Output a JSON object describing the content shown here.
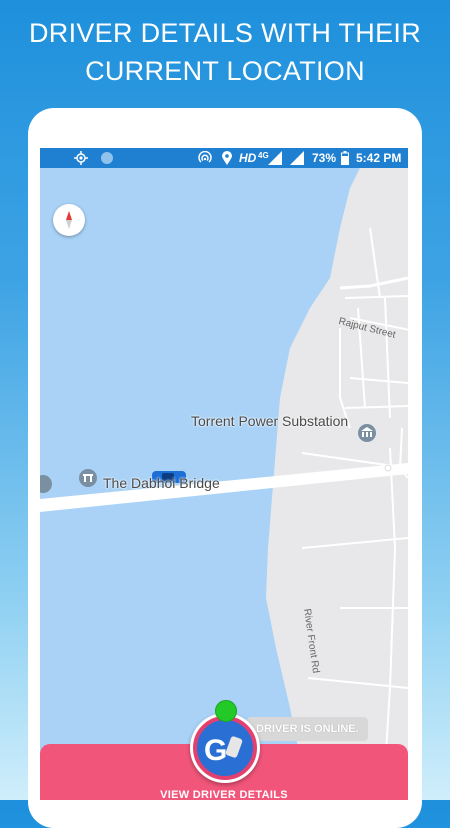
{
  "header": {
    "line1": "DRIVER DETAILS WITH THEIR",
    "line2": "CURRENT LOCATION"
  },
  "status_bar": {
    "network": "HD",
    "network_type": "4G",
    "battery": "73%",
    "time": "5:42 PM"
  },
  "map": {
    "labels": {
      "bridge": "The Dabhoi Bridge",
      "substation": "Torrent Power Substation",
      "street1": "Rajput Street",
      "street2": "River Front Rd"
    }
  },
  "driver_status": "DRIVER IS ONLINE.",
  "cta_label": "VIEW DRIVER DETAILS",
  "colors": {
    "status_bar": "#1f7fd0",
    "water": "#a9d2f6",
    "land": "#e8e8ea",
    "cta": "#f2557a",
    "online": "#22c927"
  },
  "icons": [
    "gps-icon",
    "sync-icon",
    "hotspot-icon",
    "location-icon",
    "signal-icon",
    "battery-icon",
    "compass-icon",
    "car-icon",
    "poi-icon",
    "app-logo-icon"
  ]
}
